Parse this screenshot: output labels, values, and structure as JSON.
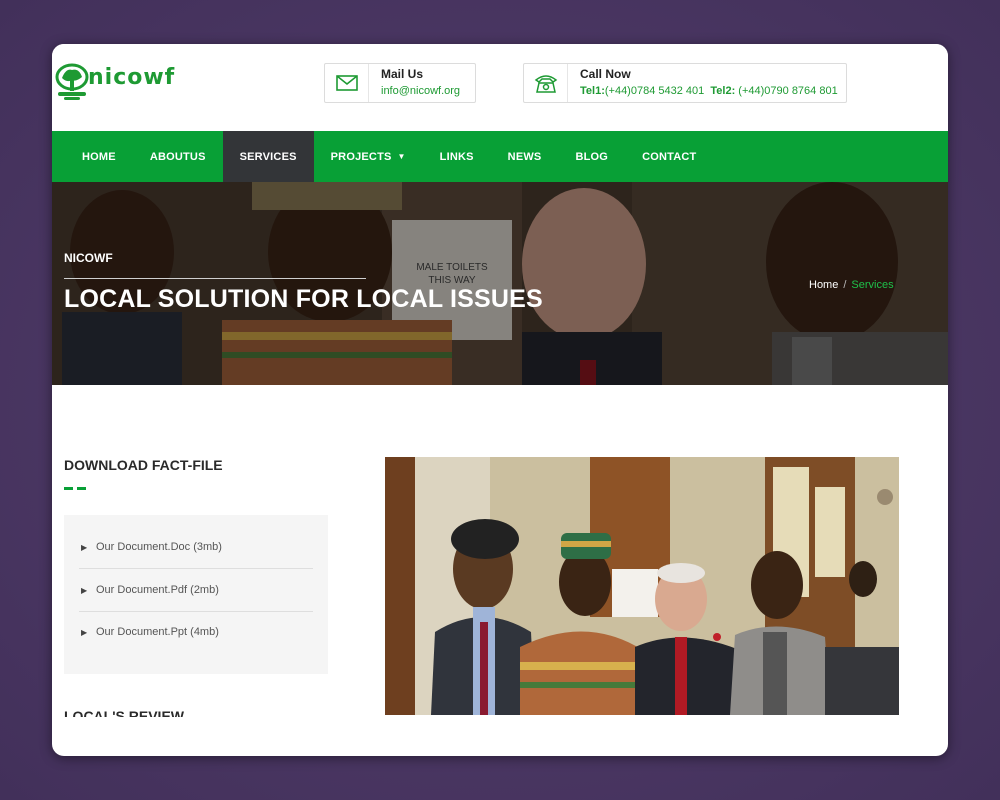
{
  "brand": {
    "name": "nicowf",
    "color": "#1e9a33"
  },
  "header": {
    "mail": {
      "title": "Mail Us",
      "value": "info@nicowf.org",
      "icon": "envelope-icon"
    },
    "call": {
      "title": "Call Now",
      "tel1_label": "Tel1:",
      "tel1_value": "(+44)0784 5432 401",
      "tel2_label": "Tel2:",
      "tel2_value": " (+44)0790 8764 801",
      "icon": "telephone-icon"
    }
  },
  "nav": {
    "color": "#08a036",
    "active_color": "#333538",
    "items": [
      {
        "label": "HOME"
      },
      {
        "label": "ABOUTUS"
      },
      {
        "label": "SERVICES",
        "active": true
      },
      {
        "label": "PROJECTS",
        "has_dropdown": true
      },
      {
        "label": "LINKS"
      },
      {
        "label": "NEWS"
      },
      {
        "label": "BLOG"
      },
      {
        "label": "CONTACT"
      }
    ]
  },
  "hero": {
    "kicker": "NICOWF",
    "title": "LOCAL SOLUTION FOR LOCAL ISSUES",
    "sign_text_1": "MALE TOILETS",
    "sign_text_2": "THIS WAY",
    "breadcrumb": {
      "home": "Home",
      "separator": "/",
      "current": "Services"
    }
  },
  "sidebar": {
    "title": "DOWNLOAD FACT-FILE",
    "documents": [
      {
        "label": "Our Document.Doc (3mb)"
      },
      {
        "label": "Our Document.Pdf (2mb)"
      },
      {
        "label": "Our Document.Ppt (4mb)"
      }
    ],
    "next_title": "LOCAL'S REVIEW"
  }
}
